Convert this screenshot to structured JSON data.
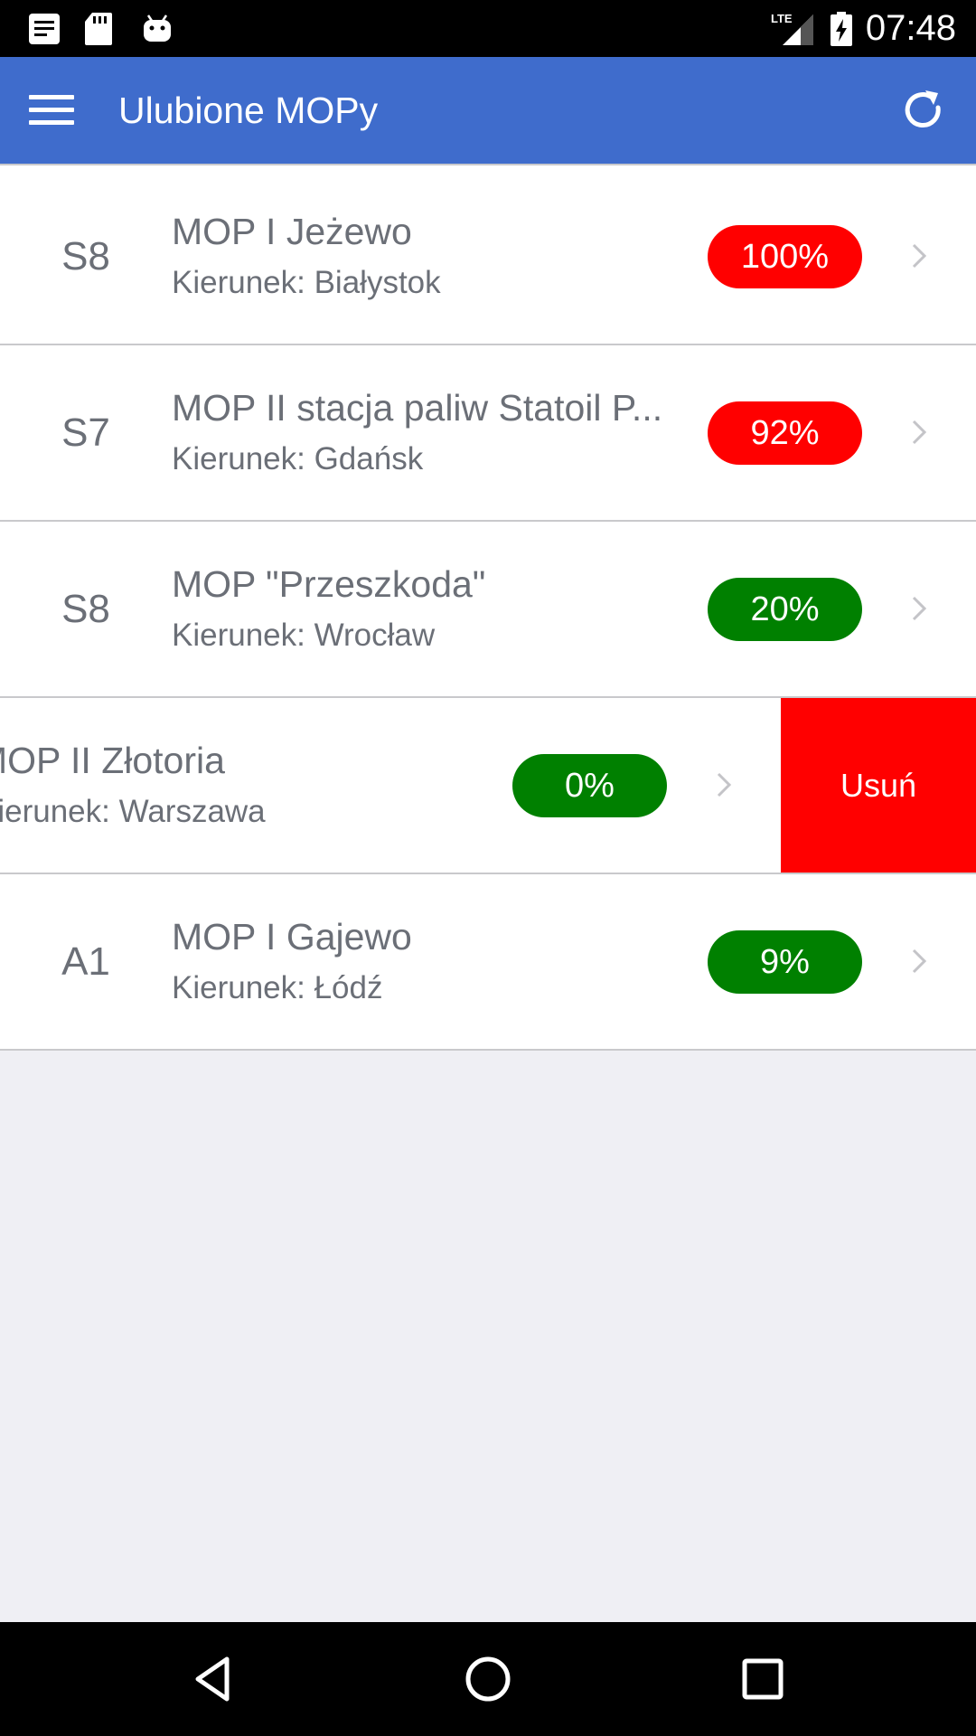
{
  "status_bar": {
    "time": "07:48",
    "network_label": "LTE",
    "icons": [
      "notes-icon",
      "sd-card-icon",
      "android-icon",
      "signal-icon",
      "battery-charging-icon"
    ]
  },
  "app_bar": {
    "title": "Ulubione MOPy",
    "menu_icon": "hamburger-menu-icon",
    "refresh_icon": "refresh-icon"
  },
  "rows": [
    {
      "road": "S8",
      "name": "MOP I Jeżewo",
      "direction": "Kierunek: Białystok",
      "occupancy": "100%",
      "status": "red"
    },
    {
      "road": "S7",
      "name": "MOP II stacja paliw Statoil P...",
      "direction": "Kierunek: Gdańsk",
      "occupancy": "92%",
      "status": "red"
    },
    {
      "road": "S8",
      "name": "MOP \"Przeszkoda\"",
      "direction": "Kierunek: Wrocław",
      "occupancy": "20%",
      "status": "green"
    },
    {
      "road": "",
      "name": "MOP II Złotoria",
      "direction": "Kierunek: Warszawa",
      "occupancy": "0%",
      "status": "green",
      "swiped": true,
      "delete_label": "Usuń"
    },
    {
      "road": "A1",
      "name": "MOP I Gajewo",
      "direction": "Kierunek: Łódź",
      "occupancy": "9%",
      "status": "green"
    }
  ],
  "colors": {
    "app_bar": "#3f6ccc",
    "badge_red": "#ff0000",
    "badge_green": "#008000",
    "delete": "#ff0000",
    "background": "#efeff4"
  },
  "nav_bar": {
    "buttons": [
      "back-icon",
      "home-icon",
      "recents-icon"
    ]
  }
}
